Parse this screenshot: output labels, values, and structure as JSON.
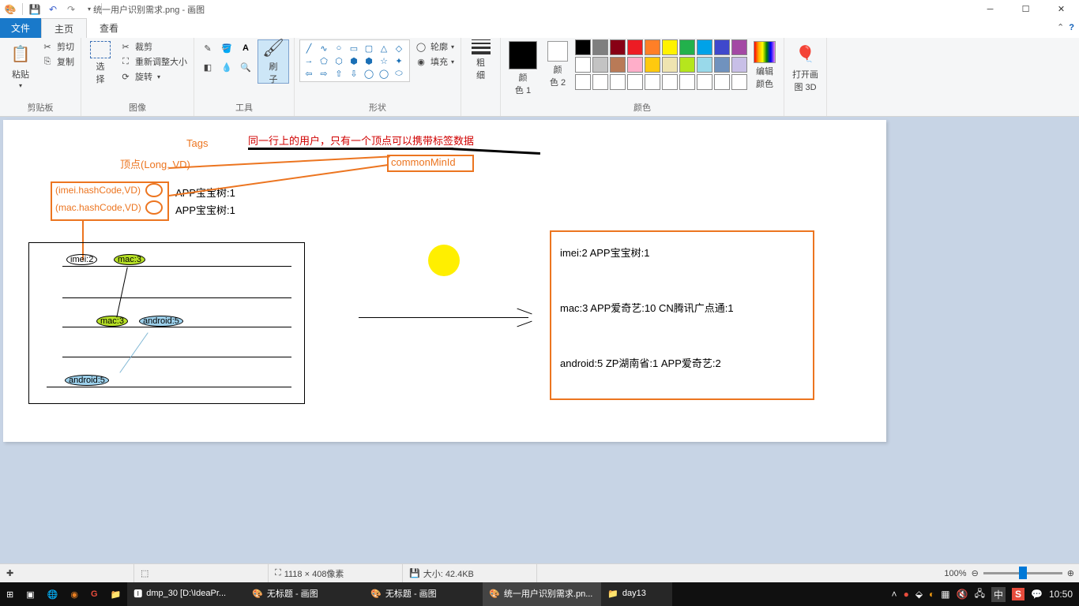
{
  "title": "统一用户识别需求.png - 画图",
  "qat": {
    "save": "💾",
    "undo": "↶",
    "redo": "↷"
  },
  "tabs": {
    "file": "文件",
    "home": "主页",
    "view": "查看"
  },
  "ribbon": {
    "clipboard": {
      "name": "剪贴板",
      "paste": "粘贴",
      "cut": "剪切",
      "copy": "复制"
    },
    "image": {
      "name": "图像",
      "select": "选\n择",
      "crop": "裁剪",
      "resize": "重新调整大小",
      "rotate": "旋转"
    },
    "tools": {
      "name": "工具",
      "brush": "刷\n子"
    },
    "shapes": {
      "name": "形状",
      "outline": "轮廓",
      "fill": "填充"
    },
    "size": {
      "name": "",
      "label": "粗\n细"
    },
    "colors": {
      "name": "颜色",
      "c1": "颜\n色 1",
      "c2": "颜\n色 2",
      "edit": "编辑\n颜色"
    },
    "paint3d": "打开画\n图 3D"
  },
  "help": {
    "minimize": "▴"
  },
  "canvas": {
    "tags": "Tags",
    "vertex": "顶点(Long, VD)",
    "redline": "同一行上的用户，只有一个顶点可以携带标签数据",
    "commonMinId": "commonMinId",
    "imeiHash": "(imei.hashCode,VD)",
    "macHash": "(mac.hashCode,VD)",
    "app1": "APP宝宝树:1",
    "app2": "APP宝宝树:1",
    "n_imei2": "imei:2",
    "n_mac3": "mac:3",
    "n_android5": "android:5",
    "r1": "imei:2  APP宝宝树:1",
    "r2": "mac:3 APP爱奇艺:10 CN腾讯广点通:1",
    "r3": "android:5   ZP湖南省:1   APP爱奇艺:2"
  },
  "status": {
    "dim": "1118 × 408像素",
    "size": "大小: 42.4KB",
    "zoom": "100%"
  },
  "taskbar": {
    "t1": "dmp_30 [D:\\IdeaPr...",
    "t2": "无标题 - 画图",
    "t3": "无标题 - 画图",
    "t4": "统一用户识别需求.pn...",
    "t5": "day13",
    "time": "10:50",
    "ime": "中"
  }
}
